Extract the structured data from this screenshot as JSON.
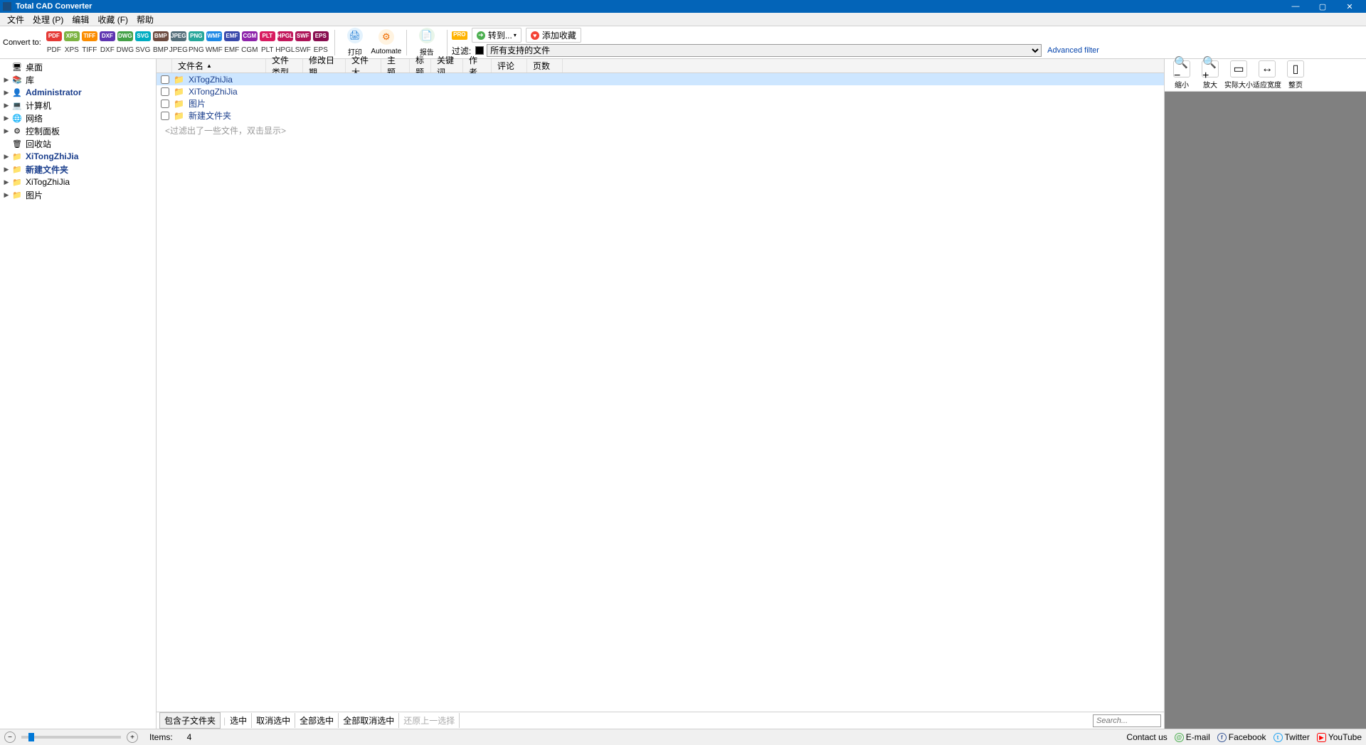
{
  "window": {
    "title": "Total CAD Converter",
    "min": "—",
    "max": "▢",
    "close": "✕"
  },
  "menu": [
    "文件",
    "处理 (P)",
    "编辑",
    "收藏 (F)",
    "帮助"
  ],
  "toolbar": {
    "convert_to": "Convert to:",
    "formats": [
      {
        "code": "PDF",
        "color": "#e53935"
      },
      {
        "code": "XPS",
        "color": "#7cb342"
      },
      {
        "code": "TIFF",
        "color": "#fb8c00"
      },
      {
        "code": "DXF",
        "color": "#5e35b1"
      },
      {
        "code": "DWG",
        "color": "#43a047"
      },
      {
        "code": "SVG",
        "color": "#00acc1"
      },
      {
        "code": "BMP",
        "color": "#6d4c41"
      },
      {
        "code": "JPEG",
        "color": "#546e7a"
      },
      {
        "code": "PNG",
        "color": "#26a69a"
      },
      {
        "code": "WMF",
        "color": "#1e88e5"
      },
      {
        "code": "EMF",
        "color": "#3949ab"
      },
      {
        "code": "CGM",
        "color": "#8e24aa"
      },
      {
        "code": "PLT",
        "color": "#d81b60"
      },
      {
        "code": "HPGL",
        "color": "#c2185b"
      },
      {
        "code": "SWF",
        "color": "#ad1457"
      },
      {
        "code": "EPS",
        "color": "#880e4f"
      }
    ],
    "print": "打印",
    "automate": "Automate",
    "report": "报告",
    "pro": "PRO",
    "gotobtn": "转到...",
    "addfav": "添加收藏",
    "filter_label": "过滤:",
    "filter_value": "所有支持的文件",
    "advanced_filter": "Advanced filter"
  },
  "tree": [
    {
      "label": "桌面",
      "icon": "desktop",
      "expand": "",
      "bold": false,
      "color": "#0078d7"
    },
    {
      "label": "库",
      "icon": "lib",
      "expand": "▶",
      "bold": false
    },
    {
      "label": "Administrator",
      "icon": "user",
      "expand": "▶",
      "bold": true
    },
    {
      "label": "计算机",
      "icon": "pc",
      "expand": "▶",
      "bold": false
    },
    {
      "label": "网络",
      "icon": "net",
      "expand": "▶",
      "bold": false
    },
    {
      "label": "控制面板",
      "icon": "cpl",
      "expand": "▶",
      "bold": false
    },
    {
      "label": "回收站",
      "icon": "bin",
      "expand": "",
      "bold": false
    },
    {
      "label": "XiTongZhiJia",
      "icon": "folder",
      "expand": "▶",
      "bold": true
    },
    {
      "label": "新建文件夹",
      "icon": "folder",
      "expand": "▶",
      "bold": true
    },
    {
      "label": "XiTogZhiJia",
      "icon": "folder",
      "expand": "▶",
      "bold": false
    },
    {
      "label": "图片",
      "icon": "folder",
      "expand": "▶",
      "bold": false
    }
  ],
  "columns": [
    "文件名",
    "文件类型",
    "修改日期",
    "文件大...",
    "主题",
    "标题",
    "关键词",
    "作者",
    "评论",
    "页数"
  ],
  "files": [
    {
      "name": "XiTogZhiJia",
      "selected": true
    },
    {
      "name": "XiTongZhiJia",
      "selected": false
    },
    {
      "name": "图片",
      "selected": false
    },
    {
      "name": "新建文件夹",
      "selected": false
    }
  ],
  "filter_hint": "<过滤出了一些文件，双击显示>",
  "bottom": {
    "include_sub": "包含子文件夹",
    "check": "选中",
    "uncheck": "取消选中",
    "check_all": "全部选中",
    "uncheck_all": "全部取消选中",
    "restore": "还原上一选择",
    "search_ph": "Search..."
  },
  "preview_tb": [
    {
      "label": "缩小",
      "glyph": "🔍−"
    },
    {
      "label": "放大",
      "glyph": "🔍+"
    },
    {
      "label": "实际大小",
      "glyph": "▭"
    },
    {
      "label": "适应宽度",
      "glyph": "↔"
    },
    {
      "label": "整页",
      "glyph": "▯"
    }
  ],
  "status": {
    "items_label": "Items:",
    "items_count": "4",
    "contact": "Contact us",
    "email": "E-mail",
    "facebook": "Facebook",
    "twitter": "Twitter",
    "youtube": "YouTube"
  }
}
